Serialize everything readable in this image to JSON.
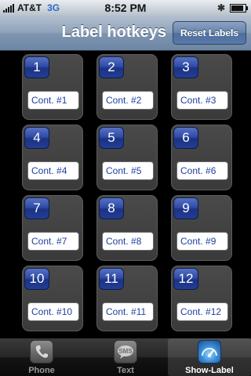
{
  "status": {
    "carrier": "AT&T",
    "network": "3G",
    "time": "8:52 PM",
    "battery_level": 0.9
  },
  "nav": {
    "title": "Label hotkeys",
    "reset_label": "Reset Labels"
  },
  "hotkeys": [
    {
      "number": "1",
      "label": "Cont. #1"
    },
    {
      "number": "2",
      "label": "Cont. #2"
    },
    {
      "number": "3",
      "label": "Cont. #3"
    },
    {
      "number": "4",
      "label": "Cont. #4"
    },
    {
      "number": "5",
      "label": "Cont. #5"
    },
    {
      "number": "6",
      "label": "Cont. #6"
    },
    {
      "number": "7",
      "label": "Cont. #7"
    },
    {
      "number": "8",
      "label": "Cont. #8"
    },
    {
      "number": "9",
      "label": "Cont. #9"
    },
    {
      "number": "10",
      "label": "Cont. #10"
    },
    {
      "number": "11",
      "label": "Cont. #11"
    },
    {
      "number": "12",
      "label": "Cont. #12"
    }
  ],
  "tabs": [
    {
      "label": "Phone",
      "icon": "phone-icon",
      "active": false
    },
    {
      "label": "Text",
      "icon": "sms-icon",
      "icon_text": "SMS",
      "active": false
    },
    {
      "label": "Show-Label",
      "icon": "speedometer-icon",
      "active": true
    }
  ]
}
